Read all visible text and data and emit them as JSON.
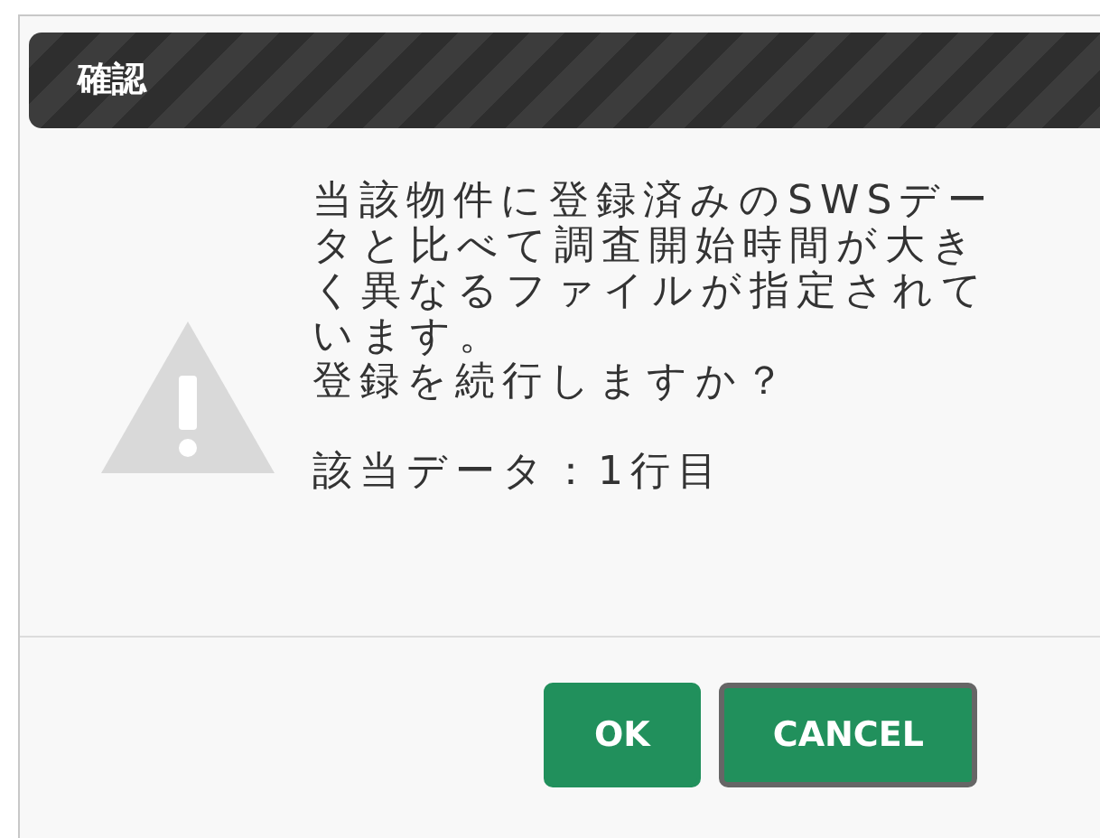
{
  "dialog": {
    "title": "確認",
    "message": [
      "当該物件に登録済みのSWSデータと比べて調査開始時間が大きく異なるファイルが指定されています。",
      "登録を続行しますか？",
      "該当データ：1行目"
    ],
    "buttons": [
      {
        "label": "OK",
        "focused": false
      },
      {
        "label": "CANCEL",
        "focused": true
      }
    ]
  }
}
